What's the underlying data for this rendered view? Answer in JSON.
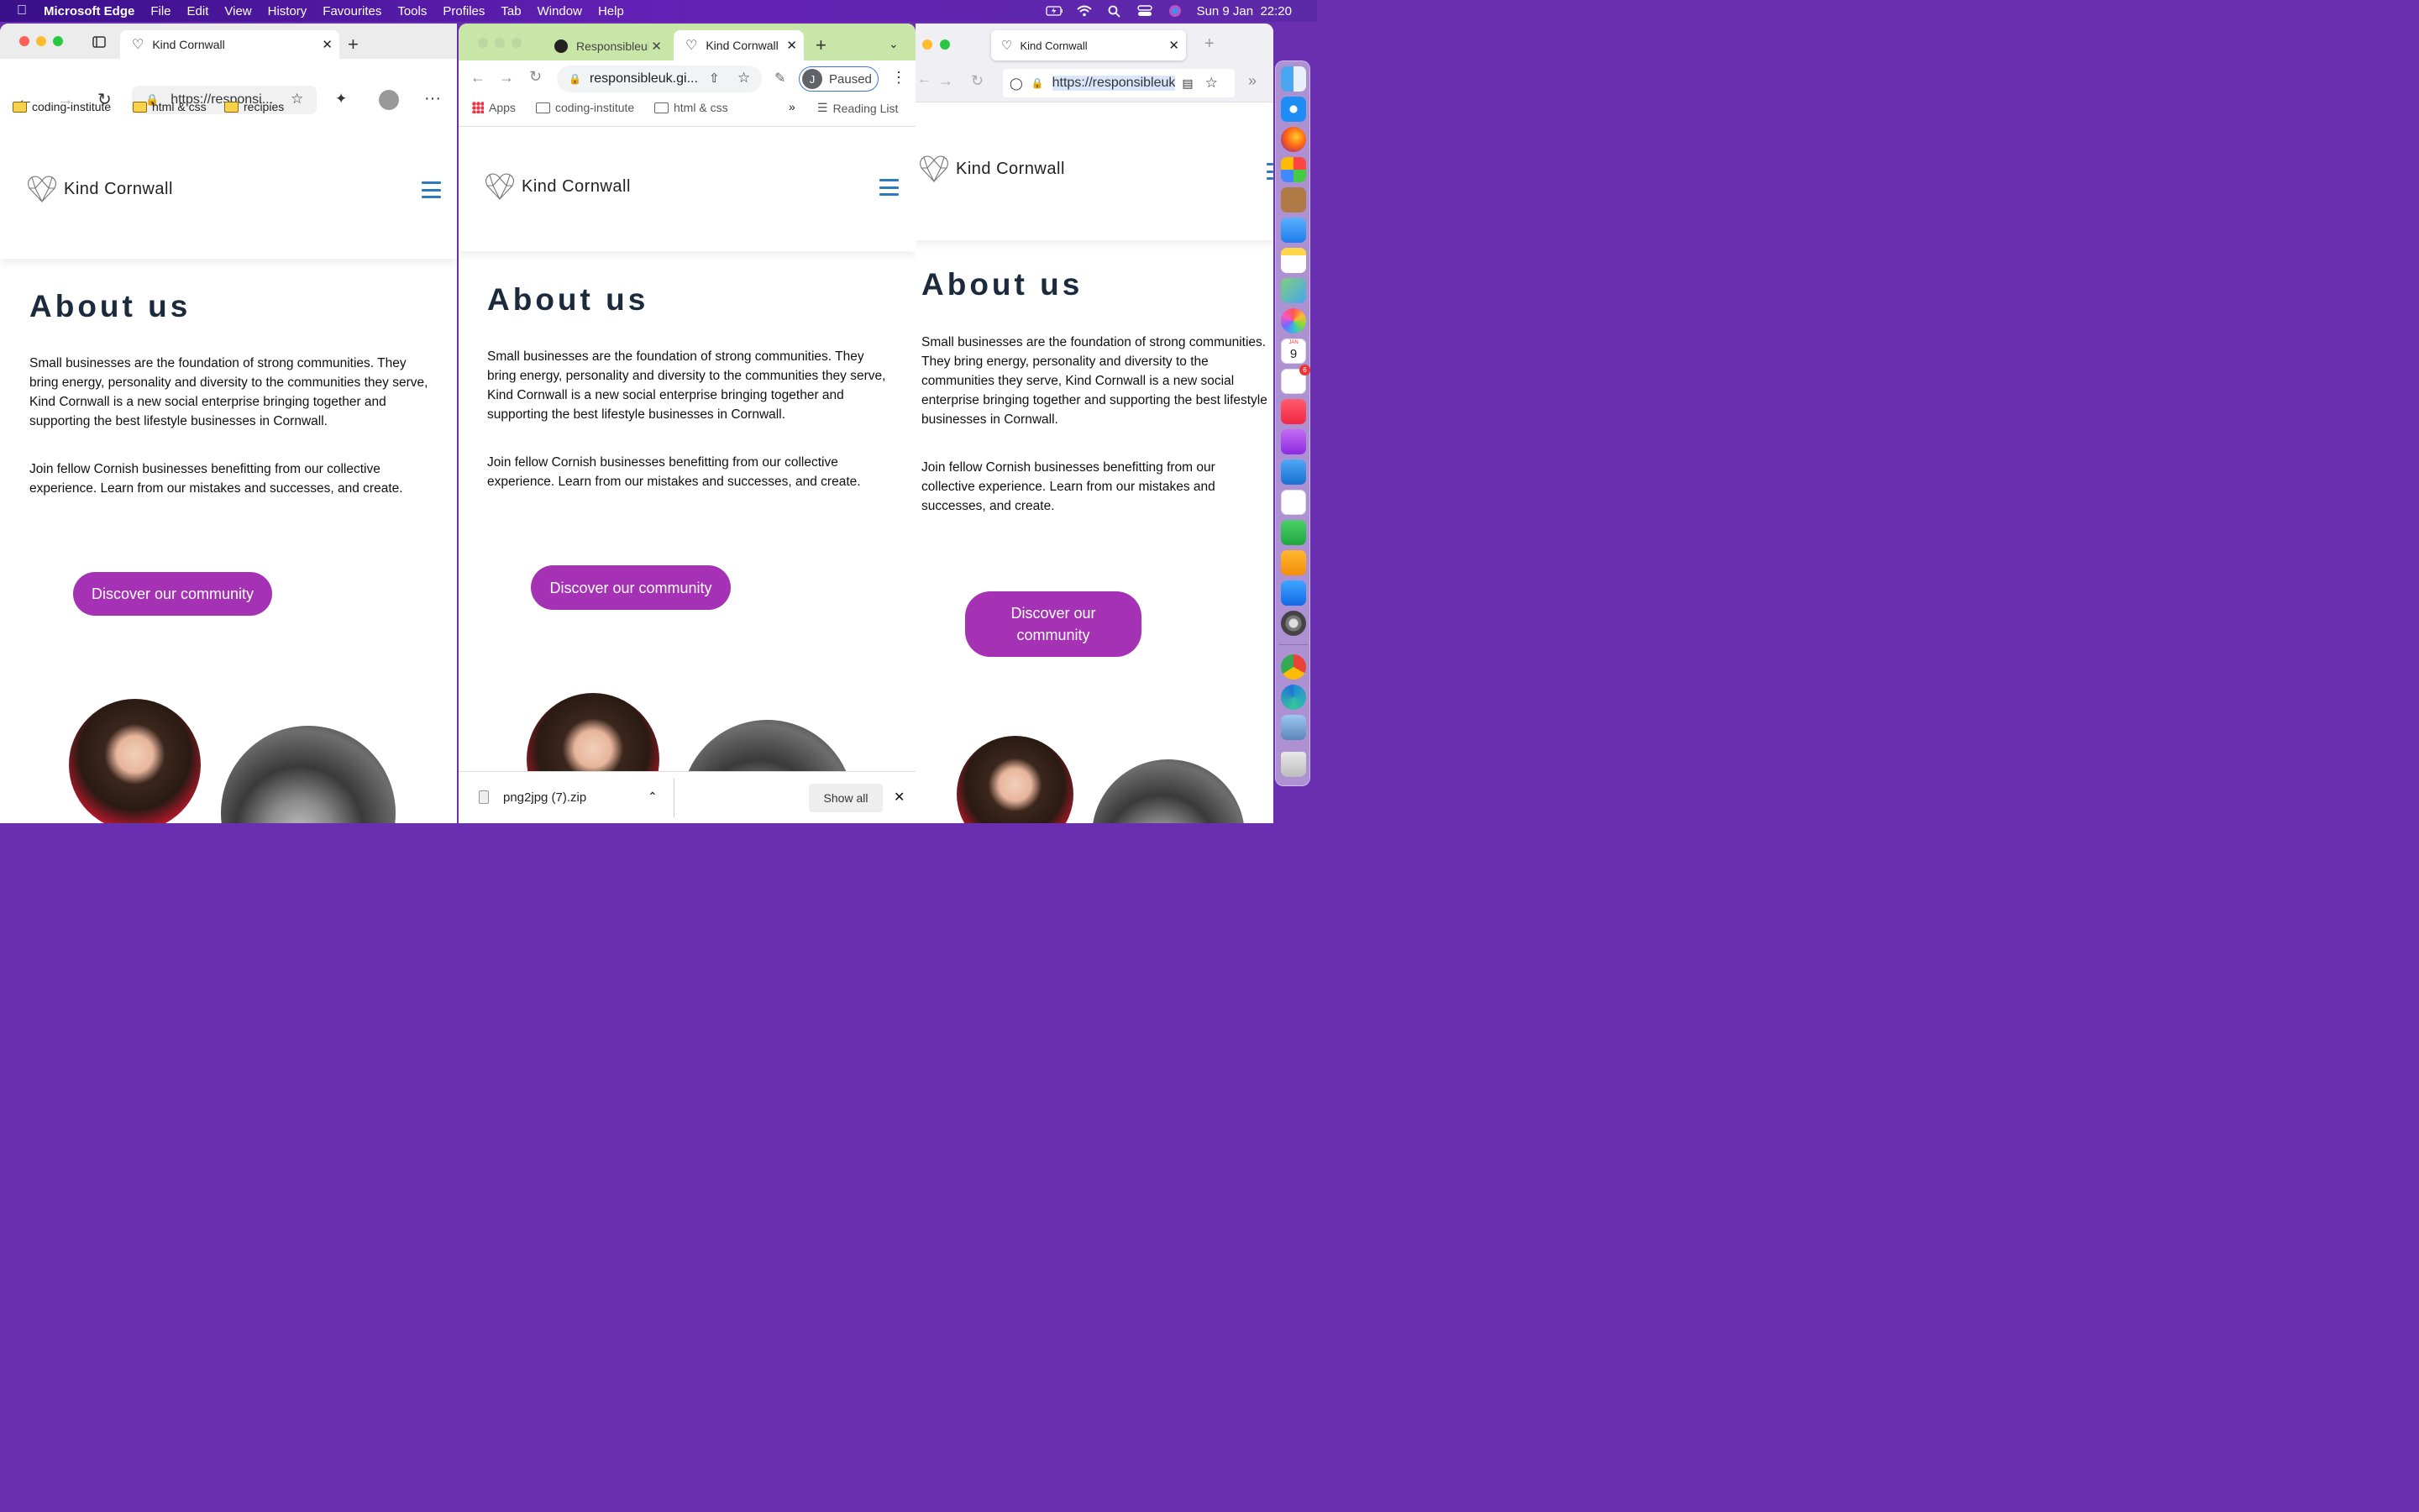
{
  "menubar": {
    "app_name": "Microsoft Edge",
    "items": [
      "File",
      "Edit",
      "View",
      "History",
      "Favourites",
      "Tools",
      "Profiles",
      "Tab",
      "Window",
      "Help"
    ],
    "clock": "Sun 9 Jan  22:20",
    "status_icons": [
      "battery-icon",
      "wifi-icon",
      "search-icon",
      "control-center-icon",
      "siri-icon"
    ]
  },
  "edge": {
    "tab_title": "Kind Cornwall",
    "url": "https://responsi...",
    "bookmarks": [
      "coding-institute",
      "html & css",
      "recipies"
    ]
  },
  "chrome": {
    "tabs": [
      {
        "title": "Responsibleuk"
      },
      {
        "title": "Kind Cornwall"
      }
    ],
    "url": "responsibleuk.gi...",
    "profile_initial": "J",
    "profile_status": "Paused",
    "bookmarks": [
      "Apps",
      "coding-institute",
      "html & css"
    ],
    "overflow": "»",
    "reading_list": "Reading List",
    "download_file": "png2jpg (7).zip",
    "show_all": "Show all"
  },
  "firefox": {
    "tab_title": "Kind Cornwall",
    "url": "https://responsibleuk"
  },
  "site": {
    "brand": "Kind Cornwall",
    "heading": "About us",
    "para1": "Small businesses are the foundation of strong communities. They bring energy, personality and diversity to the communities they serve, Kind Cornwall is a new social enterprise bringing together and supporting the best lifestyle businesses in Cornwall.",
    "para2": "Join fellow Cornish businesses benefitting from our collective experience. Learn from our mistakes and successes, and create.",
    "cta": "Discover our community"
  },
  "dock": {
    "calendar_day": "9",
    "calendar_month": "JAN",
    "reminders_badge": "6"
  },
  "colors": {
    "cta": "#a531b4",
    "burger": "#2d7bbd",
    "heading": "#1c2a3d",
    "chrome_frame": "#c8e6a8"
  }
}
